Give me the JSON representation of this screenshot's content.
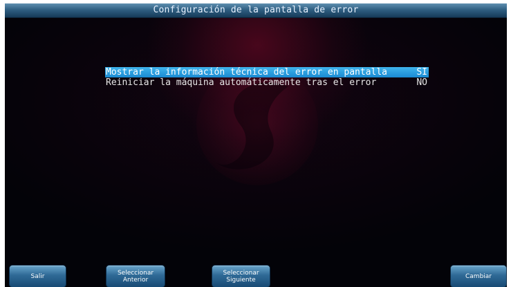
{
  "title": "Configuración de la pantalla de error",
  "options": [
    {
      "label": "Mostrar la información técnica del error en pantalla",
      "value": "SI",
      "selected": true
    },
    {
      "label": "Reiniciar la máquina automáticamente tras el error",
      "value": "NO",
      "selected": false
    }
  ],
  "buttons": {
    "exit": {
      "line1": "Salir"
    },
    "previous": {
      "line1": "Seleccionar",
      "line2": "Anterior"
    },
    "next": {
      "line1": "Seleccionar",
      "line2": "Siguiente"
    },
    "change": {
      "line1": "Cambiar"
    }
  },
  "colors": {
    "background": "#030308",
    "title_bar": "#2f5f82",
    "selection": "#1a8ad2",
    "button": "#2f6a96",
    "text": "#e8e8e8"
  },
  "watermark_icon": "brand-logo-watermark"
}
